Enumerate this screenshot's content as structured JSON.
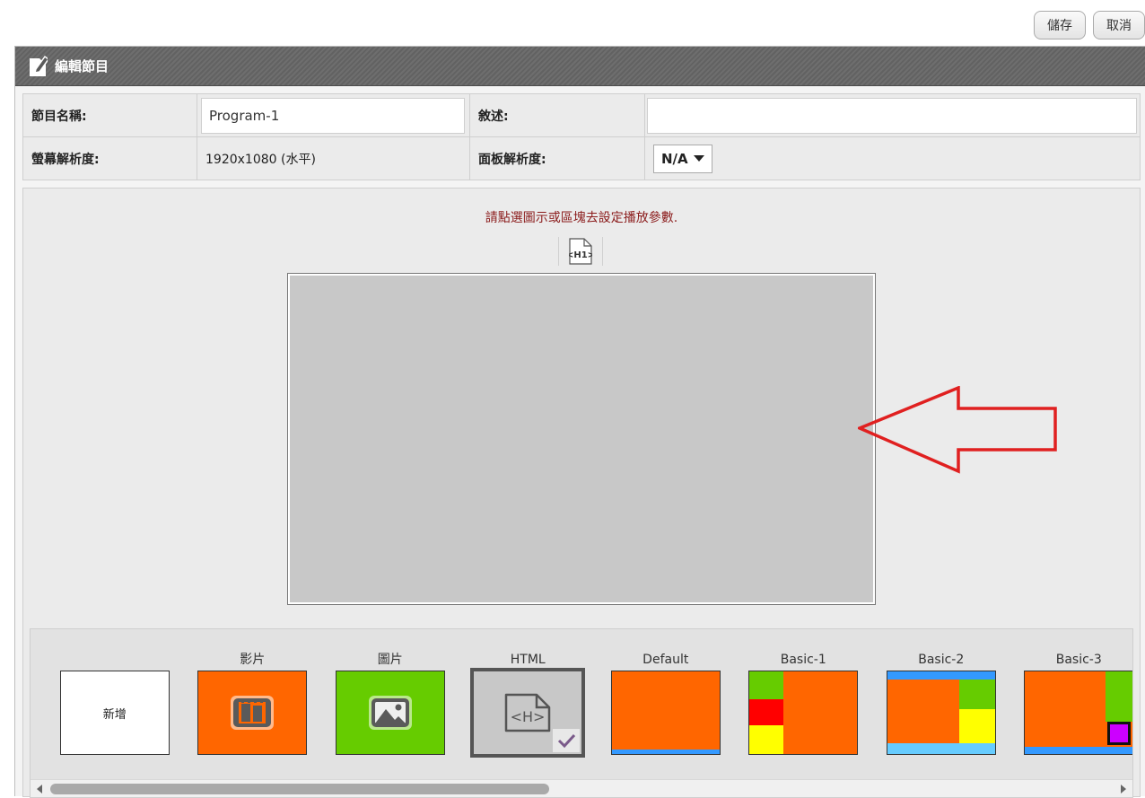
{
  "toolbar": {
    "save_label": "儲存",
    "cancel_label": "取消"
  },
  "panel": {
    "title": "編輯節目"
  },
  "form": {
    "program_name_label": "節目名稱:",
    "program_name_value": "Program-1",
    "description_label": "敘述:",
    "description_value": "",
    "screen_resolution_label": "螢幕解析度:",
    "screen_resolution_value": "1920x1080 (水平)",
    "panel_resolution_label": "面板解析度:",
    "panel_resolution_value": "N/A"
  },
  "editor": {
    "hint": "請點選圖示或區塊去設定播放參數.",
    "tool_icon": "html-h1-icon"
  },
  "templates": [
    {
      "caption": "",
      "label": "新增",
      "kind": "new"
    },
    {
      "caption": "影片",
      "icon": "video-icon",
      "color": "#ff6600"
    },
    {
      "caption": "圖片",
      "icon": "image-icon",
      "color": "#66cc00"
    },
    {
      "caption": "HTML",
      "icon": "html-icon",
      "color": "#c8c8c8",
      "selected": true
    },
    {
      "caption": "Default"
    },
    {
      "caption": "Basic-1"
    },
    {
      "caption": "Basic-2"
    },
    {
      "caption": "Basic-3"
    }
  ],
  "colors": {
    "orange": "#ff6600",
    "green": "#66cc00",
    "red": "#ff0000",
    "yellow": "#ffff00",
    "blue": "#3399ff",
    "purple": "#cc00ff",
    "arrow": "#e02020"
  }
}
